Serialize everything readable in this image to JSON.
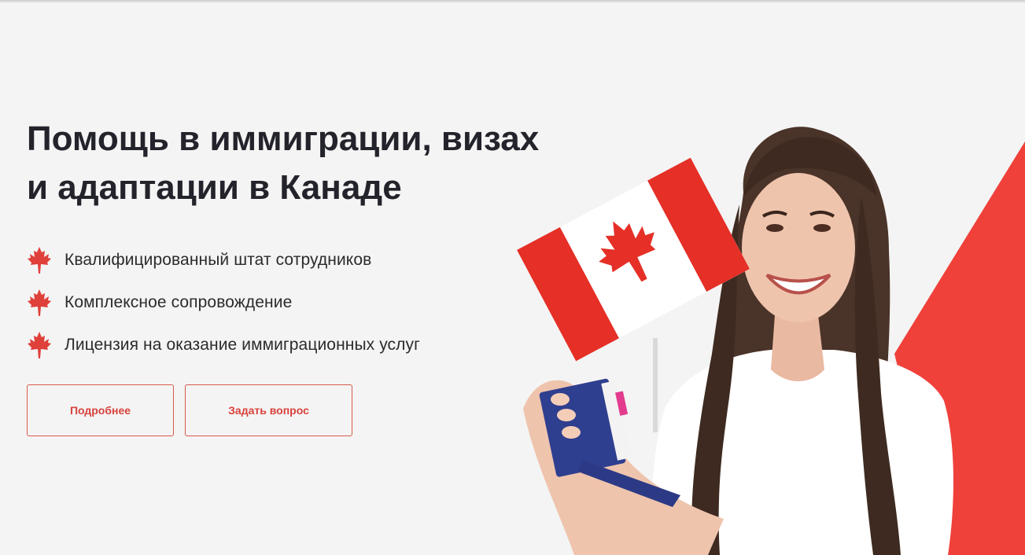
{
  "hero": {
    "title_line1": "Помощь в иммиграции, визах",
    "title_line2": "и адаптации в Канаде",
    "features": [
      "Квалифицированный штат сотрудников",
      "Комплексное сопровождение",
      "Лицензия на оказание иммиграционных услуг"
    ],
    "buttons": {
      "more_label": "Подробнее",
      "ask_label": "Задать вопрос"
    }
  },
  "icons": {
    "feature_bullet": "maple-leaf-icon"
  },
  "colors": {
    "background": "#f4f4f4",
    "accent_red": "#e63a33",
    "title_text": "#23232b",
    "button_border": "#d8594a"
  }
}
